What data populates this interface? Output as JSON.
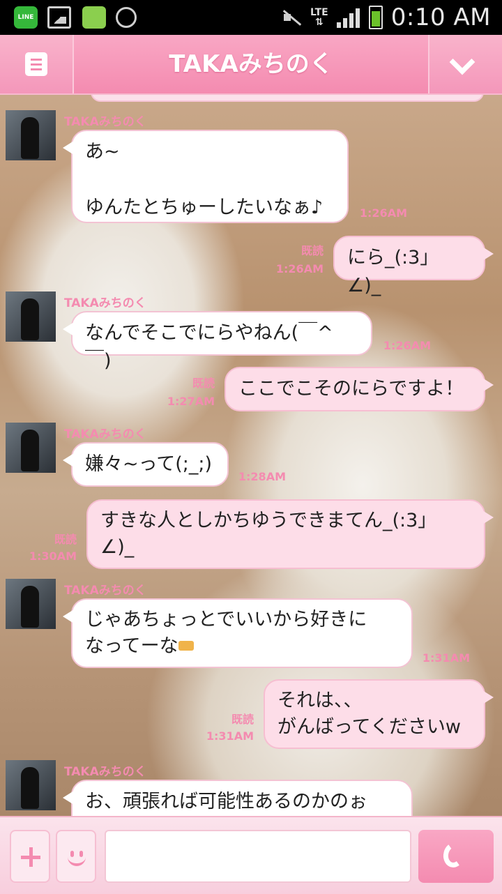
{
  "status_bar": {
    "time": "0:10 AM",
    "network": "LTE",
    "line_app_label": "LINE",
    "icons": [
      "line-app-icon",
      "gallery-icon",
      "sticker-app-icon",
      "alarm-icon",
      "mute-icon",
      "signal-icon",
      "battery-icon"
    ]
  },
  "header": {
    "title": "TAKAみちのく",
    "menu_icon": "menu-icon",
    "more_icon": "chevron-down-icon",
    "accent": "#f48bb0"
  },
  "messages": [
    {
      "sender": "TAKAみちのく",
      "text": "あ~\n\nゆんたとちゅーしたいなぁ♪",
      "time": "1:26AM"
    },
    {
      "sender": "me",
      "text": "にら_(:3」∠)_",
      "time": "1:26AM",
      "read": "既読"
    },
    {
      "sender": "TAKAみちのく",
      "text": "なんでそこでにらやねん(￣^￣)",
      "time": "1:26AM"
    },
    {
      "sender": "me",
      "text": "ここでこそのにらですよ！",
      "time": "1:27AM",
      "read": "既読"
    },
    {
      "sender": "TAKAみちのく",
      "text": "嫌々~って(;_;)",
      "time": "1:28AM"
    },
    {
      "sender": "me",
      "text": "すきな人としかちゆうできまてん_(:3」\n∠)_",
      "time": "1:30AM",
      "read": "既読"
    },
    {
      "sender": "TAKAみちのく",
      "text": "じゃあちょっとでいいから好きに\nなってーな",
      "time": "1:31AM"
    },
    {
      "sender": "me",
      "text": "それは、、\nがんばってくださいw",
      "time": "1:31AM",
      "read": "既読"
    },
    {
      "sender": "TAKAみちのく",
      "text": "お、頑張れば可能性あるのかのぉ",
      "time": ""
    }
  ],
  "composer": {
    "placeholder": "",
    "plus_icon": "plus-icon",
    "emoji_icon": "smiley-icon",
    "call_icon": "phone-icon"
  }
}
